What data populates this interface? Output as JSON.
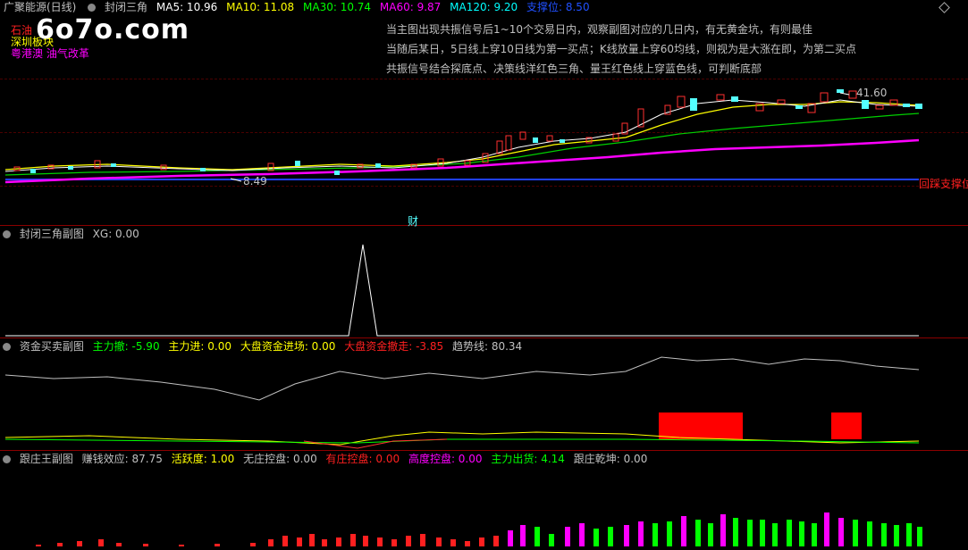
{
  "main": {
    "stock_title": "广聚能源(日线)",
    "indicator_name": "封闭三角",
    "ma": [
      {
        "label": "MA5: 10.96",
        "color": "#ffffff"
      },
      {
        "label": "MA10: 11.08",
        "color": "#ffff00"
      },
      {
        "label": "MA30: 10.74",
        "color": "#00ff00"
      },
      {
        "label": "MA60: 9.87",
        "color": "#ff00ff"
      },
      {
        "label": "MA120: 9.20",
        "color": "#00ffff"
      },
      {
        "label": "支撑位: 8.50",
        "color": "#0000ff"
      }
    ],
    "sectors": [
      {
        "label": "石油",
        "color": "#ff2020"
      },
      {
        "label": "深圳板块",
        "color": "#ffff00"
      },
      {
        "label": "粤港澳 油气改革",
        "color": "#ff00ff"
      }
    ],
    "logo": "6o7o.com",
    "notes": [
      "当主图出现共振信号后1~10个交易日内，观察副图对应的几日内，有无黄金坑，有则最佳",
      "当随后某日，5日线上穿10日线为第一买点；K线放量上穿60均线，则视为是大涨在即，为第二买点",
      "共振信号结合探底点、决策线洋红色三角、量王红色线上穿蓝色线，可判断底部"
    ],
    "high_label": "41.60",
    "low_label": "8.49",
    "support_text": "回踩支撑位",
    "cai_label": "财"
  },
  "sub1": {
    "title": "封闭三角副图",
    "xg": "XG: 0.00"
  },
  "sub2": {
    "title": "资金买卖副图",
    "items": [
      {
        "label": "主力撤: -5.90",
        "color": "#00ff00"
      },
      {
        "label": "主力进: 0.00",
        "color": "#ffff00"
      },
      {
        "label": "大盘资金进场: 0.00",
        "color": "#ffff00"
      },
      {
        "label": "大盘资金撤走: -3.85",
        "color": "#ff2020"
      },
      {
        "label": "趋势线: 80.34",
        "color": "#c0c0c0"
      }
    ]
  },
  "sub3": {
    "title": "跟庄王副图",
    "items": [
      {
        "label": "赚钱效应: 87.75",
        "color": "#c0c0c0"
      },
      {
        "label": "活跃度: 1.00",
        "color": "#ffff00"
      },
      {
        "label": "无庄控盘: 0.00",
        "color": "#c0c0c0"
      },
      {
        "label": "有庄控盘: 0.00",
        "color": "#ff2020"
      },
      {
        "label": "高度控盘: 0.00",
        "color": "#ff00ff"
      },
      {
        "label": "主力出货: 4.14",
        "color": "#00ff00"
      },
      {
        "label": "跟庄乾坤: 0.00",
        "color": "#c0c0c0"
      }
    ]
  }
}
